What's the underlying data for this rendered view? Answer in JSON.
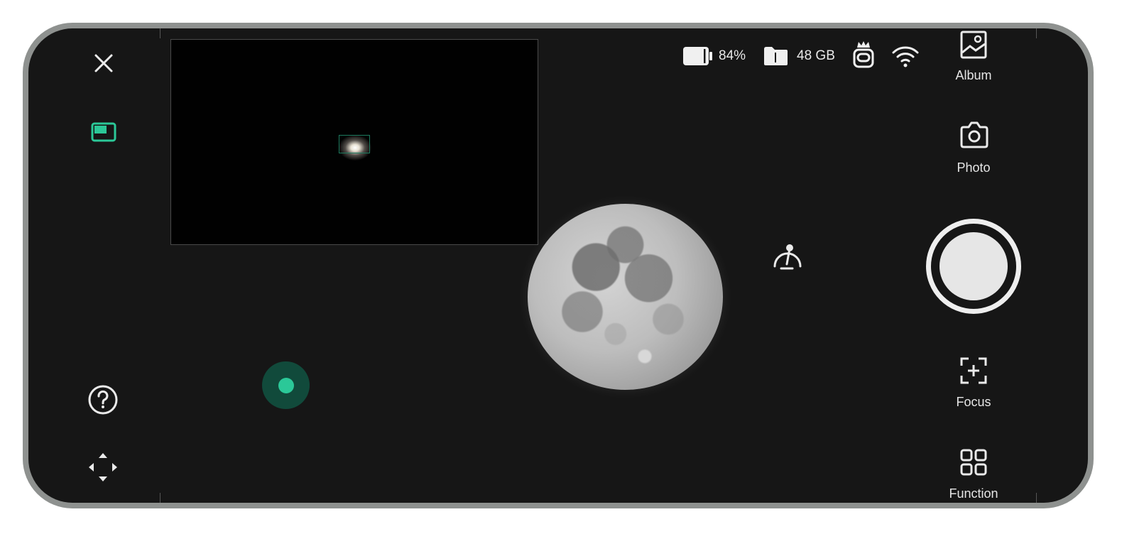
{
  "status_bar": {
    "battery_percent": "84%",
    "storage": "48 GB"
  },
  "side_panel": {
    "album_label": "Album",
    "photo_label": "Photo",
    "focus_label": "Focus",
    "function_label": "Function"
  },
  "colors": {
    "accent": "#2bc898",
    "background": "#161616",
    "bezel": "#8e918f"
  },
  "icons": [
    "close-icon",
    "pip-icon",
    "help-icon",
    "move-arrows-icon",
    "battery-icon",
    "storage-icon",
    "telescope-crown-icon",
    "wifi-icon",
    "album-icon",
    "camera-icon",
    "focus-icon",
    "function-grid-icon",
    "calibration-icon"
  ]
}
